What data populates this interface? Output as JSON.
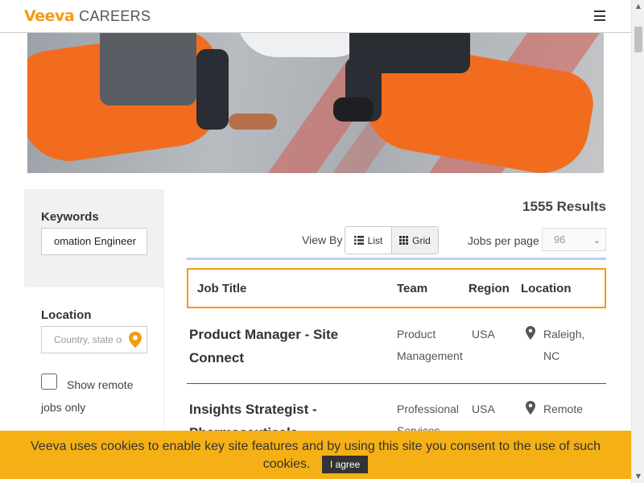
{
  "header": {
    "logo_brand": "Veeva",
    "logo_section": "CAREERS",
    "menu_icon": "hamburger-menu-icon"
  },
  "sidebar": {
    "keywords_label": "Keywords",
    "keywords_value": "omation Engineer",
    "location_label": "Location",
    "location_placeholder": "Country, state or city",
    "location_icon": "map-pin-icon",
    "remote_label_line1": "Show remote",
    "remote_label_line2": "jobs only",
    "remote_checked": false
  },
  "results": {
    "count_text": "1555 Results",
    "view_by_label": "View By",
    "view_list_label": "List",
    "view_grid_label": "Grid",
    "jobs_per_page_label": "Jobs per page",
    "jobs_per_page_value": "96"
  },
  "table": {
    "headers": {
      "title": "Job Title",
      "team": "Team",
      "region": "Region",
      "location": "Location"
    },
    "rows": [
      {
        "title": "Product Manager - Site Connect",
        "team": "Product Management",
        "region": "USA",
        "location": "Raleigh, NC"
      },
      {
        "title": "Insights Strategist - Pharmaceuticals",
        "team": "Professional Services",
        "region": "USA",
        "location": "Remote"
      }
    ]
  },
  "cookie": {
    "message": "Veeva uses cookies to enable key site features and by using this site you consent to the use of such cookies.",
    "agree_label": "I agree"
  },
  "colors": {
    "brand_orange": "#f39c12",
    "cookie_bg": "#f5b015",
    "accent_blue": "#b8d0ea"
  }
}
